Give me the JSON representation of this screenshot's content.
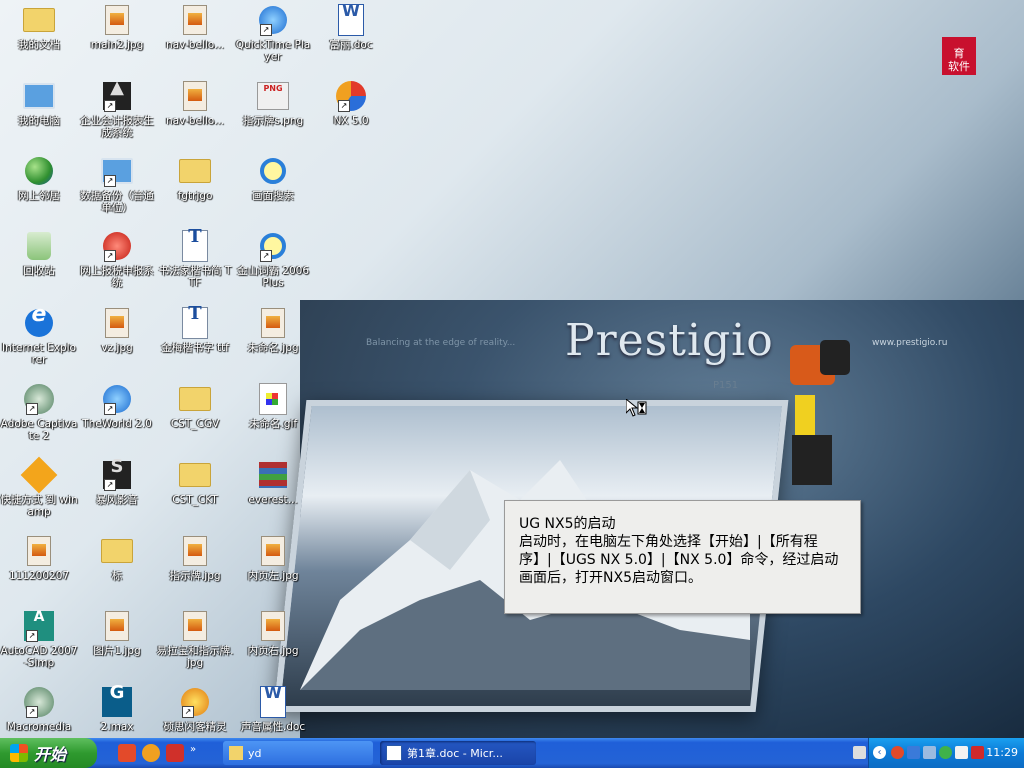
{
  "wallpaper": {
    "brand": "Prestigio",
    "tagline": "Balancing at the edge of reality...",
    "url": "www.prestigio.ru",
    "model": "P151"
  },
  "logo": {
    "line1": "育",
    "line2": "软件"
  },
  "desktop_icons": [
    {
      "label": "我的文档"
    },
    {
      "label": "我的电脑"
    },
    {
      "label": "网上邻居"
    },
    {
      "label": "回收站"
    },
    {
      "label": "Internet Explorer"
    },
    {
      "label": "Adobe Captivate 2"
    },
    {
      "label": "快捷方式 到 winamp"
    },
    {
      "label": "111200207"
    },
    {
      "label": "AutoCAD 2007-Simp"
    },
    {
      "label": "Macromedia"
    },
    {
      "label": "main2.jpg"
    },
    {
      "label": "企业会计报表生成系统"
    },
    {
      "label": "数据备份（普通单位）"
    },
    {
      "label": "网上报税申报系统"
    },
    {
      "label": "vz.jpg"
    },
    {
      "label": "TheWorld 2.0"
    },
    {
      "label": "暴风影音"
    },
    {
      "label": "标"
    },
    {
      "label": "图片1.jpg"
    },
    {
      "label": "2.max"
    },
    {
      "label": "nav-bello..."
    },
    {
      "label": "nav-bello..."
    },
    {
      "label": "fgtrjgo"
    },
    {
      "label": "书法家楷书简 TTF"
    },
    {
      "label": "金梅楷书字 ttf"
    },
    {
      "label": "CST_CGV"
    },
    {
      "label": "CST_CKT"
    },
    {
      "label": "指示牌.jpg"
    },
    {
      "label": "易拉宝和指示牌.jpg"
    },
    {
      "label": "硕思闪客精灵"
    },
    {
      "label": "QuickTime Player"
    },
    {
      "label": "指示牌s.png"
    },
    {
      "label": "画面搜索"
    },
    {
      "label": "金山词霸 2006 Plus"
    },
    {
      "label": "未命名.jpg"
    },
    {
      "label": "未命名.gif"
    },
    {
      "label": "everest..."
    },
    {
      "label": "内页左.jpg"
    },
    {
      "label": "内页右.jpg"
    },
    {
      "label": "声音属性.doc"
    },
    {
      "label": "富丽.doc"
    },
    {
      "label": "NX 5.0"
    }
  ],
  "tooltip": {
    "title": "UG NX5的启动",
    "body": "启动时，在电脑左下角处选择【开始】|【所有程序】|【UGS NX 5.0】|【NX 5.0】命令，经过启动画面后，打开NX5启动窗口。"
  },
  "taskbar": {
    "start_label": "开始",
    "tasks": [
      {
        "label": "yd"
      },
      {
        "label": "第1章.doc - Micr..."
      }
    ],
    "clock": "11:29"
  }
}
